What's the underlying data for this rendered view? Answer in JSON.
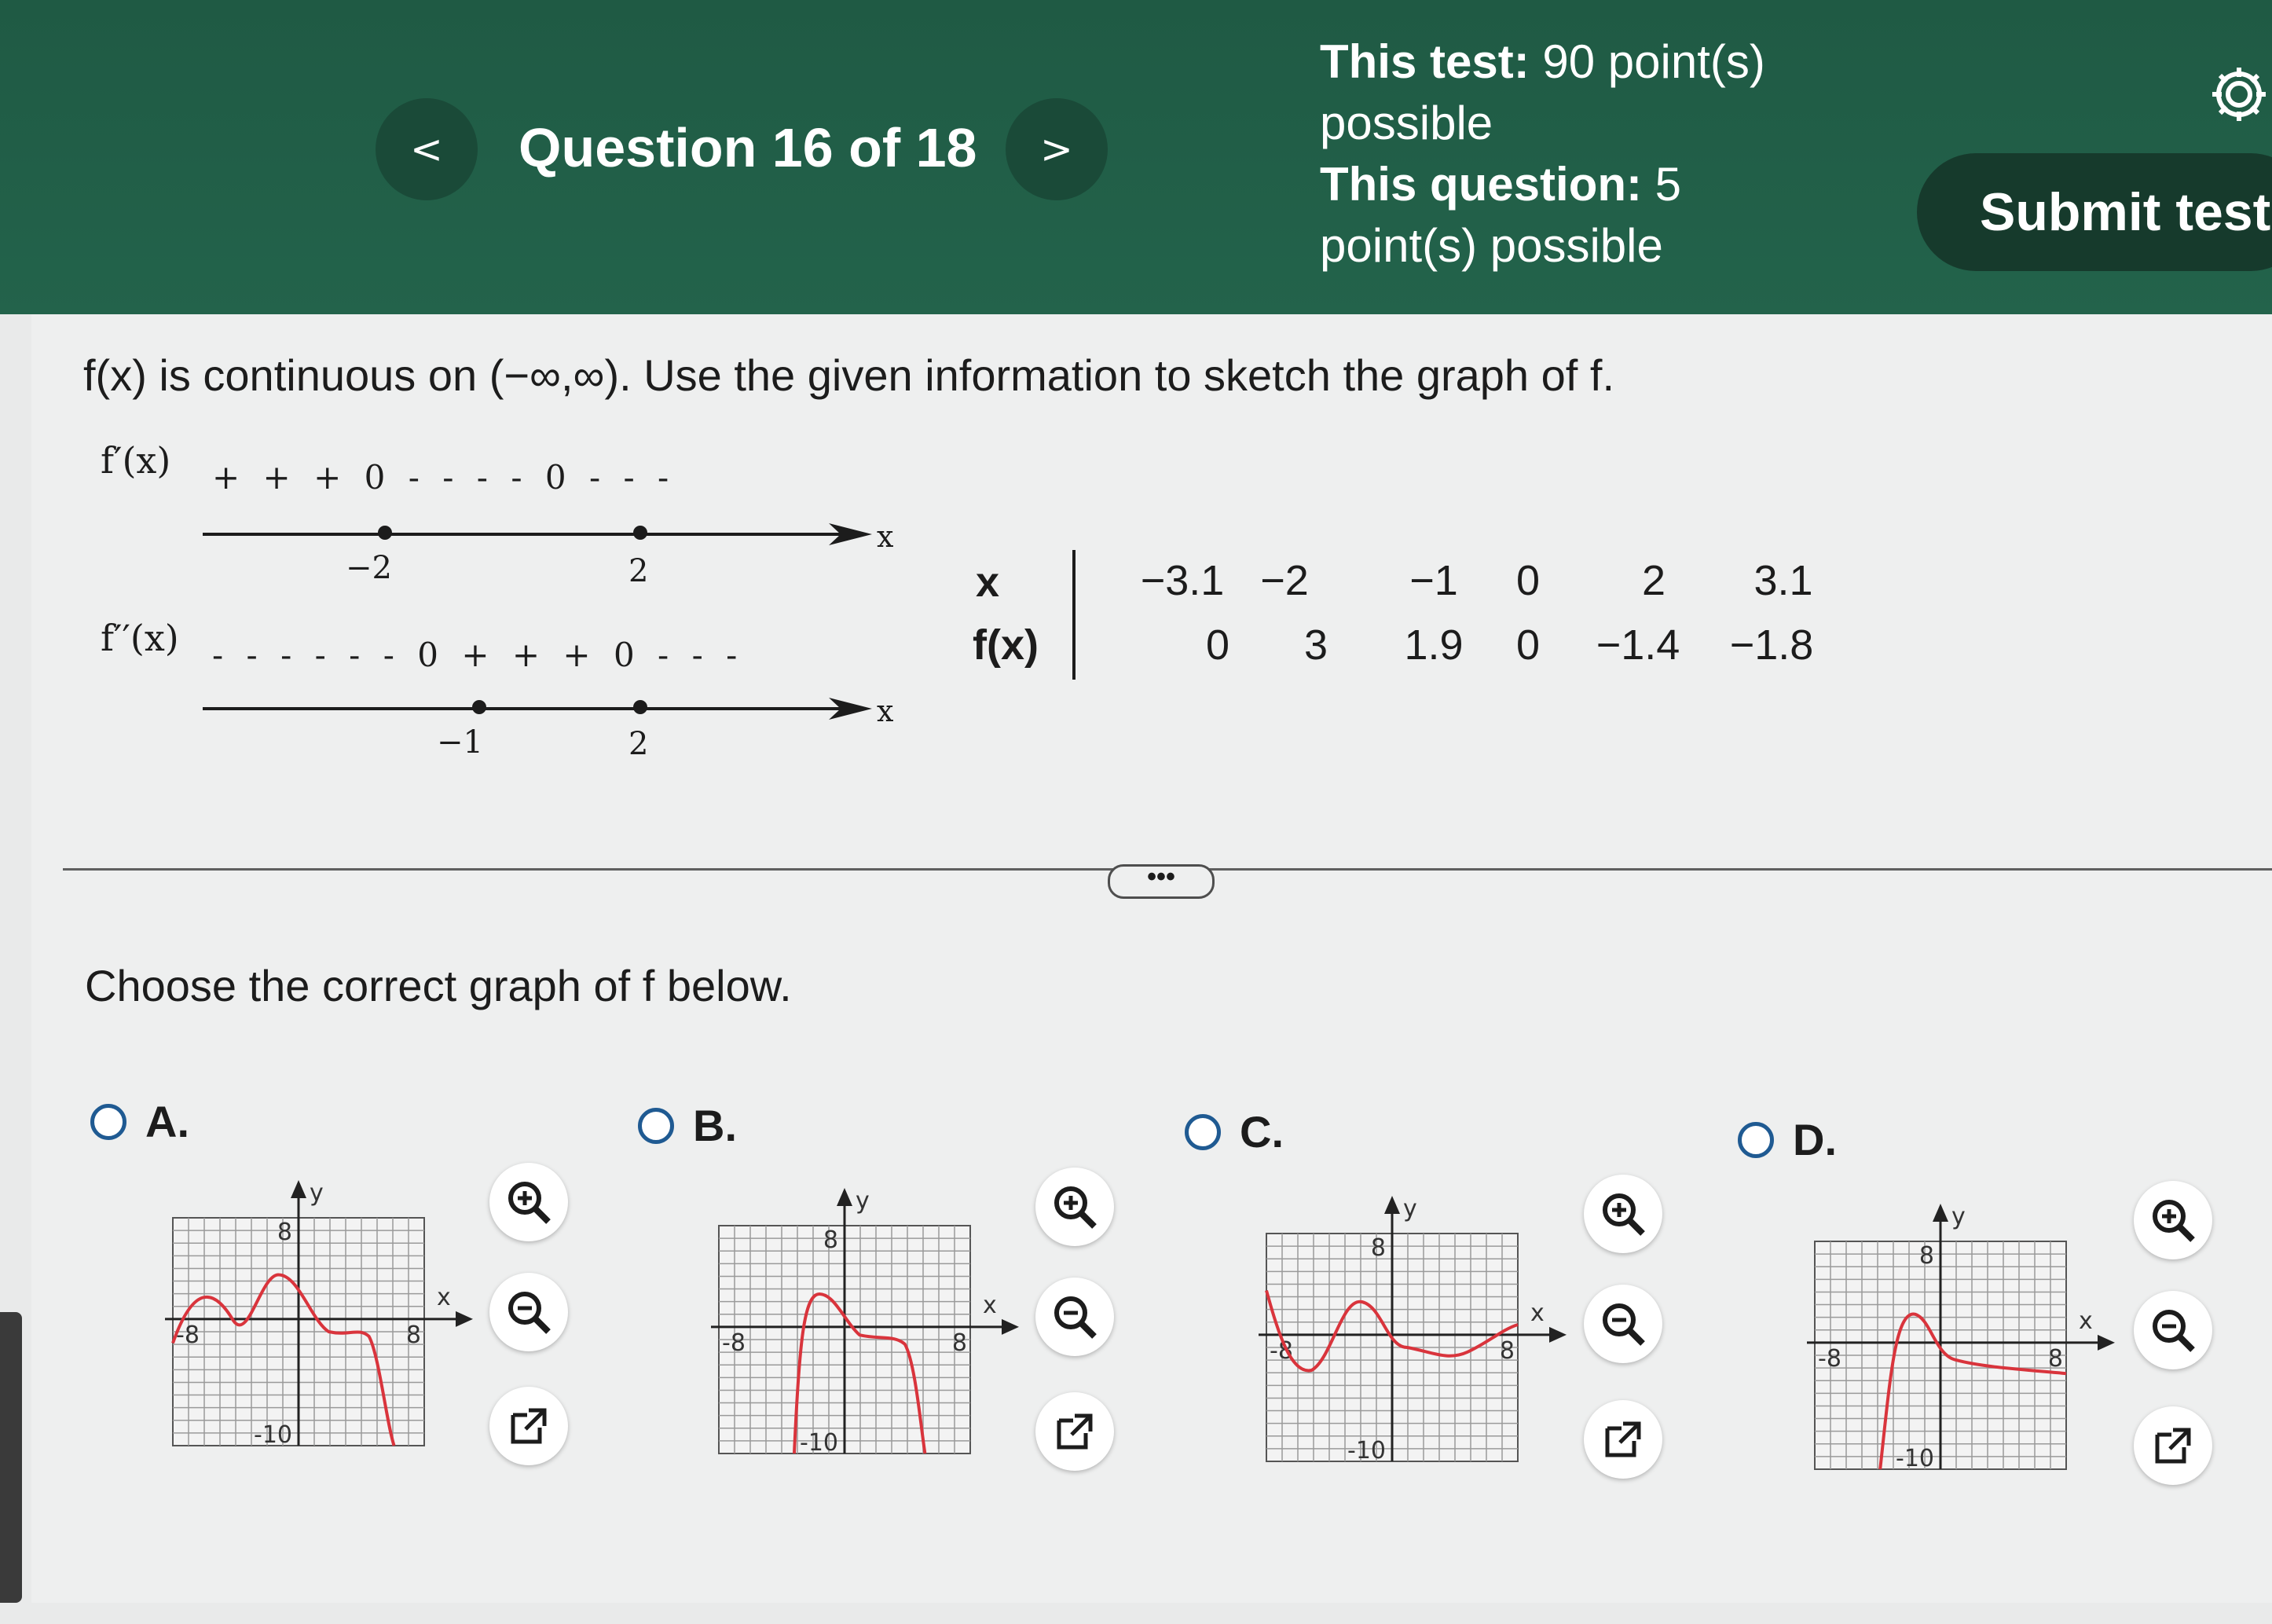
{
  "header": {
    "prev_label": "<",
    "next_label": ">",
    "question_title": "Question 16 of 18",
    "test_label": "This test:",
    "test_points": "90 point(s) possible",
    "question_label": "This question:",
    "question_points": "5 point(s) possible",
    "submit_label": "Submit test",
    "settings_icon": "gear-icon"
  },
  "problem": {
    "prompt": "f(x) is continuous on (−∞,∞). Use the given information to sketch the graph of f.",
    "fprime_label": "f′(x)",
    "fprime_signs": "+ + + 0 - - - - 0 - - -",
    "fprime_points": [
      "−2",
      "2"
    ],
    "fdouble_label": "f′′(x)",
    "fdouble_signs": "- - - - - - 0 + + + 0 - - -",
    "fdouble_points": [
      "−1",
      "2"
    ],
    "axis_x": "x",
    "table": {
      "x_label": "x",
      "fx_label": "f(x)",
      "x_values": [
        "−3.1",
        "−2",
        "−1",
        "0",
        "2",
        "3.1"
      ],
      "fx_values": [
        "0",
        "3",
        "1.9",
        "0",
        "−1.4",
        "−1.8"
      ]
    },
    "more_label": "•••"
  },
  "choose_prompt": "Choose the correct graph of f below.",
  "options": [
    {
      "letter": "A.",
      "y_label": "y",
      "x_label": "x",
      "y_tick_top": "8",
      "y_tick_bottom": "-10",
      "x_tick_left": "-8",
      "x_tick_right": "8"
    },
    {
      "letter": "B.",
      "y_label": "y",
      "x_label": "x",
      "y_tick_top": "8",
      "y_tick_bottom": "-10",
      "x_tick_left": "-8",
      "x_tick_right": "8"
    },
    {
      "letter": "C.",
      "y_label": "y",
      "x_label": "x",
      "y_tick_top": "8",
      "y_tick_bottom": "-10",
      "x_tick_left": "-8",
      "x_tick_right": "8"
    },
    {
      "letter": "D.",
      "y_label": "y",
      "x_label": "x",
      "y_tick_top": "8",
      "y_tick_bottom": "-10",
      "x_tick_left": "-8",
      "x_tick_right": "8"
    }
  ],
  "colors": {
    "header_green": "#23634b",
    "curve_red": "#d9343c",
    "radio_blue": "#1f5a92"
  }
}
